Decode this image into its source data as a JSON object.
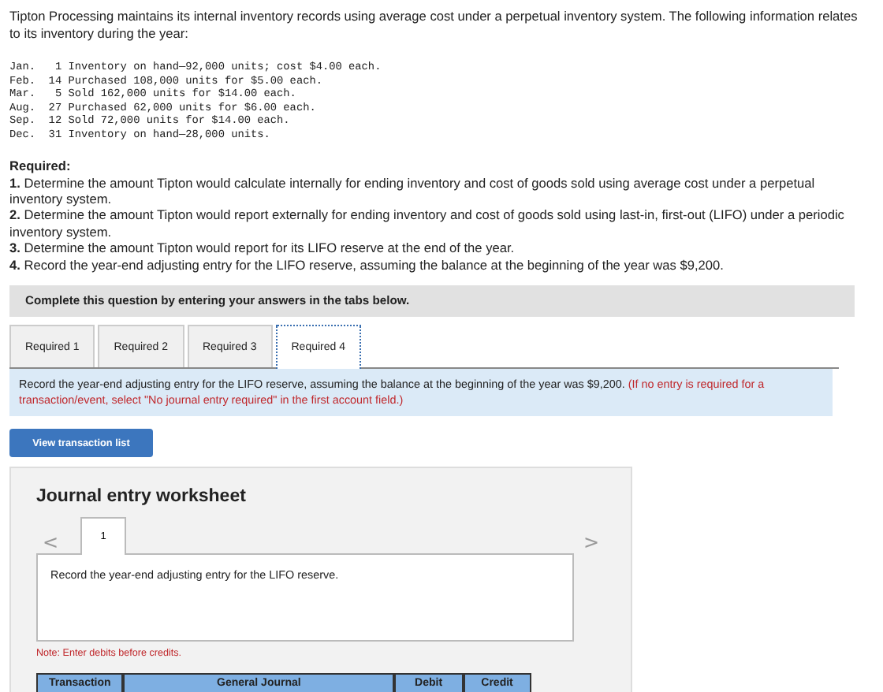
{
  "intro": "Tipton Processing maintains its internal inventory records using average cost under a perpetual inventory system. The following information relates to its inventory during the year:",
  "transactions": [
    {
      "month": "Jan.",
      "day": "1",
      "text": "Inventory on hand—92,000 units; cost $4.00 each."
    },
    {
      "month": "Feb.",
      "day": "14",
      "text": "Purchased 108,000 units for $5.00 each."
    },
    {
      "month": "Mar.",
      "day": "5",
      "text": "Sold 162,000 units for $14.00 each."
    },
    {
      "month": "Aug.",
      "day": "27",
      "text": "Purchased 62,000 units for $6.00 each."
    },
    {
      "month": "Sep.",
      "day": "12",
      "text": "Sold 72,000 units for $14.00 each."
    },
    {
      "month": "Dec.",
      "day": "31",
      "text": "Inventory on hand—28,000 units."
    }
  ],
  "required_heading": "Required:",
  "requirements": [
    "**1.** Determine the amount Tipton would calculate internally for ending inventory and cost of goods sold using average cost under a perpetual inventory system.",
    "**2.** Determine the amount Tipton would report externally for ending inventory and cost of goods sold using last-in, first-out (LIFO) under a periodic inventory system.",
    "**3.** Determine the amount Tipton would report for its LIFO reserve at the end of the year.",
    "**4.** Record the year-end adjusting entry for the LIFO reserve, assuming the balance at the beginning of the year was $9,200."
  ],
  "banner": "Complete this question by entering your answers in the tabs below.",
  "tabs": [
    {
      "label": "Required 1",
      "selected": false
    },
    {
      "label": "Required 2",
      "selected": false
    },
    {
      "label": "Required 3",
      "selected": false
    },
    {
      "label": "Required 4",
      "selected": true
    }
  ],
  "instruction": "Record the year-end adjusting entry for the LIFO reserve, assuming the balance at the beginning of the year was $9,200.",
  "instruction_note": "(If no entry is required for a transaction/event, select \"No journal entry required\" in the first account field.)",
  "view_button": "View transaction list",
  "worksheet": {
    "title": "Journal entry worksheet",
    "prev": "<",
    "next": ">",
    "pages": [
      {
        "label": "1",
        "selected": true
      }
    ],
    "prompt": "Record the year-end adjusting entry for the LIFO reserve.",
    "note": "Note: Enter debits before credits.",
    "columns": [
      "Transaction",
      "General Journal",
      "Debit",
      "Credit"
    ]
  }
}
